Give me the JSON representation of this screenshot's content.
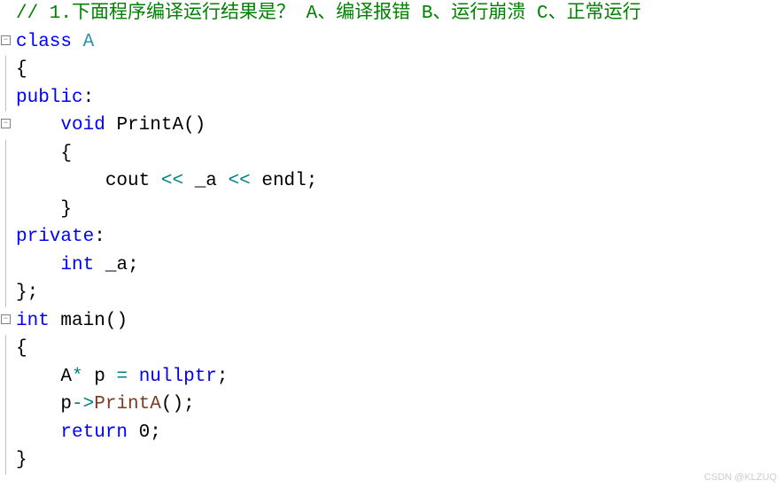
{
  "code": {
    "comment_line": "// 1.下面程序编译运行结果是？ A、编译报错 B、运行崩溃 C、正常运行",
    "k_class": "class",
    "type_A": "A",
    "brace_open": "{",
    "brace_close": "}",
    "k_public": "public",
    "colon": ":",
    "k_void": "void",
    "m_PrintA": "PrintA",
    "parens": "()",
    "cout": "cout",
    "lshift": "<<",
    "name_a": "_a",
    "endl": "endl",
    "semi": ";",
    "k_private": "private",
    "k_int": "int",
    "brace_close_semi": "};",
    "m_main": "main",
    "type_A2": "A",
    "star": "*",
    "p": "p",
    "eq": "=",
    "k_nullptr": "nullptr",
    "arrow": "->",
    "k_return": "return",
    "zero": "0"
  },
  "watermark": "CSDN @KLZUQ"
}
